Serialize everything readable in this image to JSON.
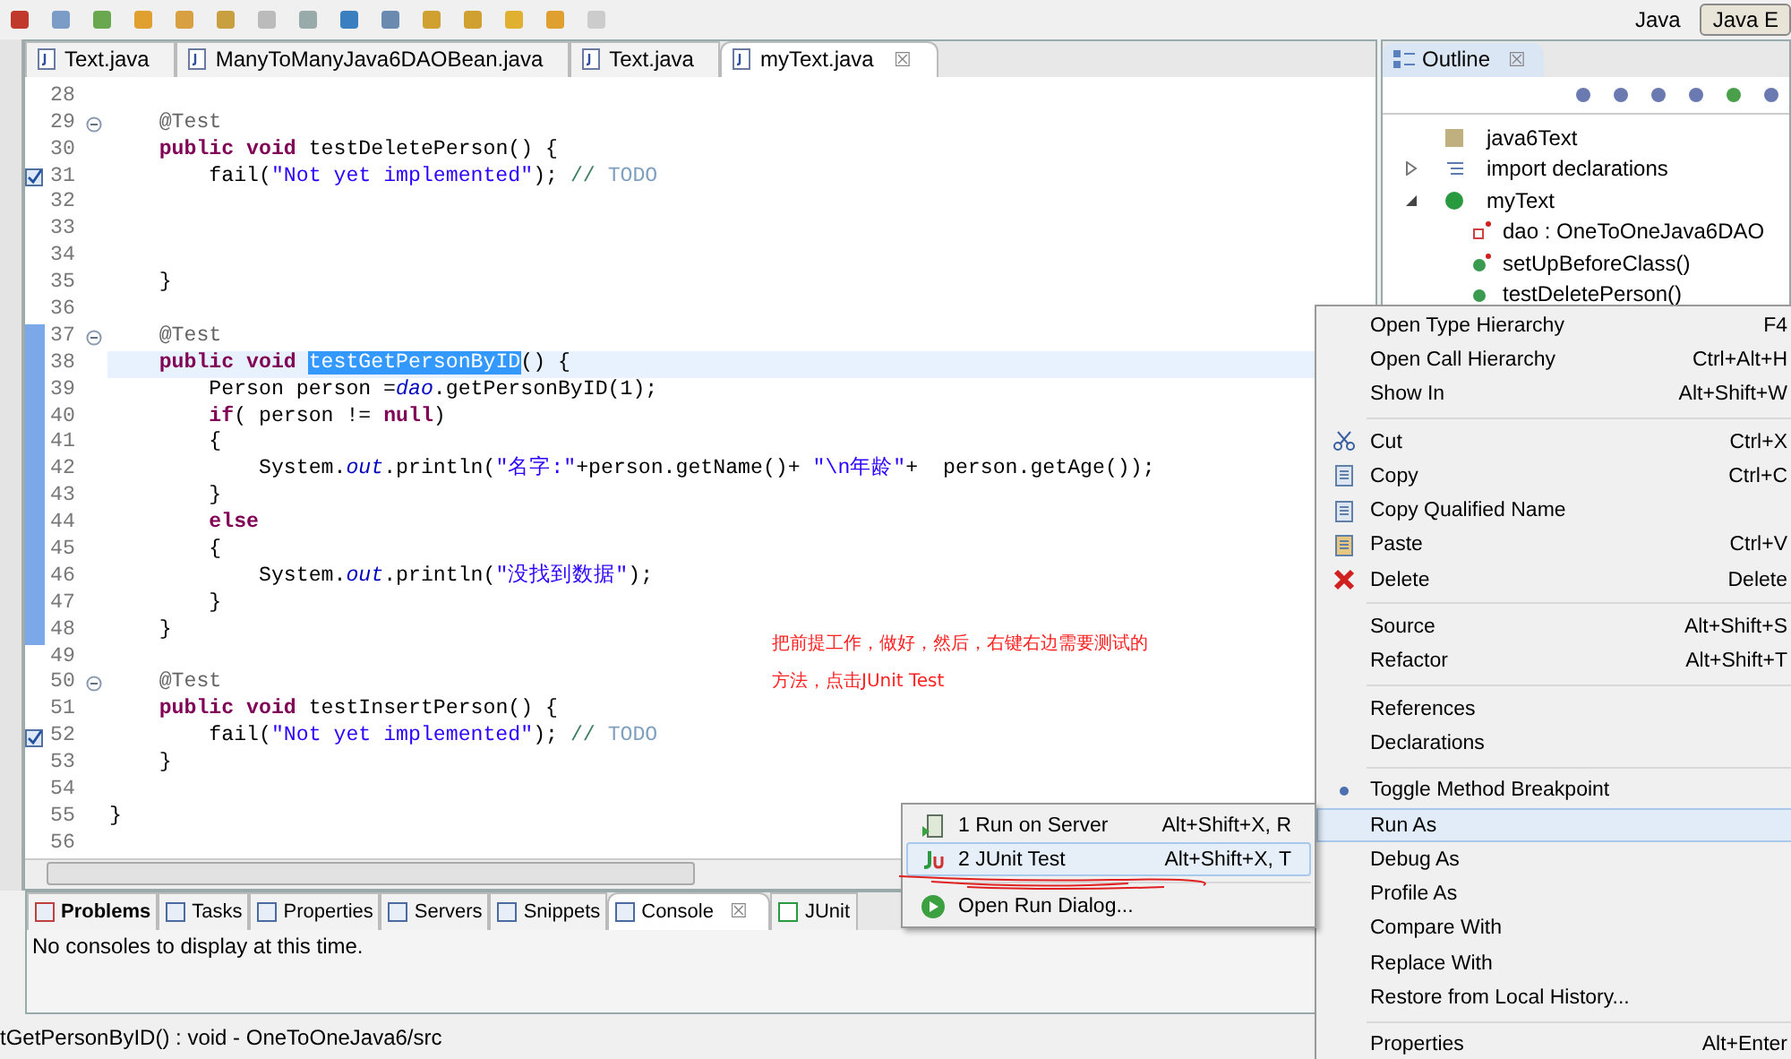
{
  "perspectives": [
    {
      "label": "Java",
      "selected": false
    },
    {
      "label": "Java E",
      "selected": true
    }
  ],
  "editor_tabs": [
    {
      "label": "Text.java",
      "selected": false
    },
    {
      "label": "ManyToManyJava6DAOBean.java",
      "selected": false
    },
    {
      "label": "Text.java",
      "selected": false
    },
    {
      "label": "myText.java",
      "selected": true,
      "close": "☒"
    }
  ],
  "code": [
    {
      "no": "28"
    },
    {
      "no": "29",
      "foldable": true,
      "segs": [
        {
          "kind": "ann",
          "t": "    @Test"
        }
      ]
    },
    {
      "no": "30",
      "segs": [
        {
          "kind": "kw",
          "t": "    public void"
        },
        {
          "kind": "plain",
          "t": " testDeletePerson() {"
        }
      ]
    },
    {
      "no": "31",
      "task": true,
      "segs": [
        {
          "kind": "plain",
          "t": "        fail("
        },
        {
          "kind": "str",
          "t": "\"Not yet implemented\""
        },
        {
          "kind": "plain",
          "t": "); "
        },
        {
          "kind": "comment",
          "t": "// "
        },
        {
          "kind": "todo",
          "t": "TODO"
        }
      ]
    },
    {
      "no": "32"
    },
    {
      "no": "33"
    },
    {
      "no": "34"
    },
    {
      "no": "35",
      "segs": [
        {
          "kind": "plain",
          "t": "    }"
        }
      ]
    },
    {
      "no": "36"
    },
    {
      "no": "37",
      "foldable": true,
      "changed": true,
      "segs": [
        {
          "kind": "ann",
          "t": "    @Test"
        }
      ]
    },
    {
      "no": "38",
      "changed": true,
      "current": true,
      "segs": [
        {
          "kind": "kw",
          "t": "    public void "
        },
        {
          "kind": "sel",
          "t": "testGetPersonByID"
        },
        {
          "kind": "plain",
          "t": "() {"
        }
      ]
    },
    {
      "no": "39",
      "changed": true,
      "segs": [
        {
          "kind": "plain",
          "t": "        Person person ="
        },
        {
          "kind": "field",
          "t": "dao"
        },
        {
          "kind": "plain",
          "t": ".getPersonByID(1);"
        }
      ]
    },
    {
      "no": "40",
      "changed": true,
      "segs": [
        {
          "kind": "kw",
          "t": "        if"
        },
        {
          "kind": "plain",
          "t": "( person != "
        },
        {
          "kind": "kw",
          "t": "null"
        },
        {
          "kind": "plain",
          "t": ")"
        }
      ]
    },
    {
      "no": "41",
      "changed": true,
      "segs": [
        {
          "kind": "plain",
          "t": "        {"
        }
      ]
    },
    {
      "no": "42",
      "changed": true,
      "segs": [
        {
          "kind": "plain",
          "t": "            System."
        },
        {
          "kind": "field",
          "t": "out"
        },
        {
          "kind": "plain",
          "t": ".println("
        },
        {
          "kind": "str",
          "t": "\"名字:\""
        },
        {
          "kind": "plain",
          "t": "+person.getName()+ "
        },
        {
          "kind": "str",
          "t": "\"\\n年龄\""
        },
        {
          "kind": "plain",
          "t": "+  person.getAge());"
        }
      ]
    },
    {
      "no": "43",
      "changed": true,
      "segs": [
        {
          "kind": "plain",
          "t": "        }"
        }
      ]
    },
    {
      "no": "44",
      "changed": true,
      "segs": [
        {
          "kind": "kw",
          "t": "        else"
        }
      ]
    },
    {
      "no": "45",
      "changed": true,
      "segs": [
        {
          "kind": "plain",
          "t": "        {"
        }
      ]
    },
    {
      "no": "46",
      "changed": true,
      "segs": [
        {
          "kind": "plain",
          "t": "            System."
        },
        {
          "kind": "field",
          "t": "out"
        },
        {
          "kind": "plain",
          "t": ".println("
        },
        {
          "kind": "str",
          "t": "\"没找到数据\""
        },
        {
          "kind": "plain",
          "t": ");"
        }
      ]
    },
    {
      "no": "47",
      "changed": true,
      "segs": [
        {
          "kind": "plain",
          "t": "        }"
        }
      ]
    },
    {
      "no": "48",
      "changed": true,
      "segs": [
        {
          "kind": "plain",
          "t": "    }"
        }
      ]
    },
    {
      "no": "49"
    },
    {
      "no": "50",
      "foldable": true,
      "segs": [
        {
          "kind": "ann",
          "t": "    @Test"
        }
      ]
    },
    {
      "no": "51",
      "segs": [
        {
          "kind": "kw",
          "t": "    public void"
        },
        {
          "kind": "plain",
          "t": " testInsertPerson() {"
        }
      ]
    },
    {
      "no": "52",
      "task": true,
      "segs": [
        {
          "kind": "plain",
          "t": "        fail("
        },
        {
          "kind": "str",
          "t": "\"Not yet implemented\""
        },
        {
          "kind": "plain",
          "t": "); "
        },
        {
          "kind": "comment",
          "t": "// "
        },
        {
          "kind": "todo",
          "t": "TODO"
        }
      ]
    },
    {
      "no": "53",
      "segs": [
        {
          "kind": "plain",
          "t": "    }"
        }
      ]
    },
    {
      "no": "54"
    },
    {
      "no": "55",
      "segs": [
        {
          "kind": "plain",
          "t": "}"
        }
      ]
    },
    {
      "no": "56"
    }
  ],
  "note": [
    "把前提工作，做好，然后，右键右边需要测试的",
    "方法，点击JUnit Test"
  ],
  "outline": {
    "title": "Outline",
    "close": "☒",
    "items": [
      {
        "label": "java6Text",
        "kind": "package"
      },
      {
        "label": "import declarations",
        "kind": "imports",
        "expanded": false
      },
      {
        "label": "myText",
        "kind": "class",
        "expanded": true,
        "children": [
          {
            "label": "dao : OneToOneJava6DAO",
            "kind": "field"
          },
          {
            "label": "setUpBeforeClass()",
            "kind": "static-method"
          },
          {
            "label": "testDeletePerson()",
            "kind": "method"
          }
        ]
      }
    ]
  },
  "context_menu": [
    [
      {
        "label": "Open Type Hierarchy",
        "shortcut": "F4"
      },
      {
        "label": "Open Call Hierarchy",
        "shortcut": "Ctrl+Alt+H"
      },
      {
        "label": "Show In",
        "shortcut": "Alt+Shift+W"
      }
    ],
    [
      {
        "label": "Cut",
        "shortcut": "Ctrl+X",
        "kind": "cut"
      },
      {
        "label": "Copy",
        "shortcut": "Ctrl+C",
        "kind": "copy"
      },
      {
        "label": "Copy Qualified Name",
        "kind": "copy"
      },
      {
        "label": "Paste",
        "shortcut": "Ctrl+V",
        "kind": "paste"
      },
      {
        "label": "Delete",
        "shortcut": "Delete",
        "kind": "delete"
      }
    ],
    [
      {
        "label": "Source",
        "shortcut": "Alt+Shift+S"
      },
      {
        "label": "Refactor",
        "shortcut": "Alt+Shift+T"
      }
    ],
    [
      {
        "label": "References"
      },
      {
        "label": "Declarations"
      }
    ],
    [
      {
        "label": "Toggle Method Breakpoint",
        "kind": "breakpoint"
      },
      {
        "label": "Run As",
        "selected": true
      },
      {
        "label": "Debug As"
      },
      {
        "label": "Profile As"
      },
      {
        "label": "Compare With"
      },
      {
        "label": "Replace With"
      },
      {
        "label": "Restore from Local History..."
      }
    ],
    [
      {
        "label": "Properties",
        "shortcut": "Alt+Enter"
      }
    ]
  ],
  "run_as_menu": [
    [
      {
        "label": "1 Run on Server",
        "shortcut": "Alt+Shift+X, R",
        "kind": "server",
        "selected": false
      },
      {
        "label": "2 JUnit Test",
        "shortcut": "Alt+Shift+X, T",
        "kind": "junit",
        "selected": true
      }
    ],
    [
      {
        "label": "Open Run Dialog...",
        "kind": "run",
        "selected": false
      }
    ]
  ],
  "bottom_tabs": [
    {
      "label": "Problems",
      "kind": "problems",
      "selected": false
    },
    {
      "label": "Tasks",
      "kind": "tasks",
      "selected": false
    },
    {
      "label": "Properties",
      "kind": "props",
      "selected": false
    },
    {
      "label": "Servers",
      "kind": "servers",
      "selected": false
    },
    {
      "label": "Snippets",
      "kind": "snippets",
      "selected": false
    },
    {
      "label": "Console",
      "kind": "console",
      "selected": true,
      "close": "☒"
    },
    {
      "label": "JUnit",
      "kind": "junit",
      "selected": false
    }
  ],
  "console_message": "No consoles to display at this time.",
  "status_bar": "tGetPersonByID() : void - OneToOneJava6/src"
}
